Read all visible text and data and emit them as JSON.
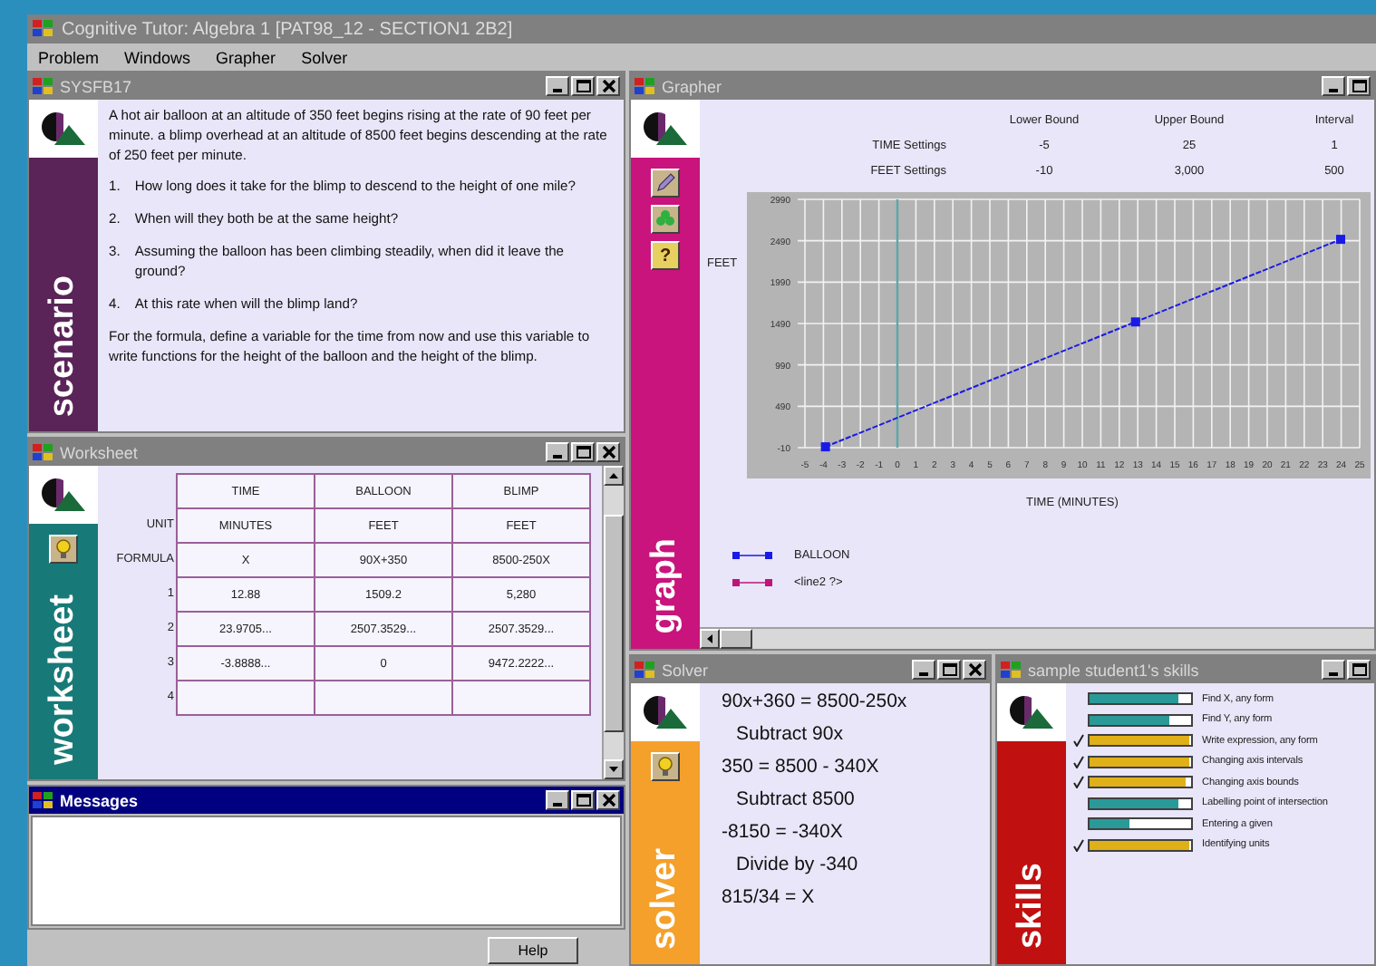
{
  "app": {
    "title": "Cognitive Tutor: Algebra 1  [PAT98_12 - SECTION1 2B2]"
  },
  "menu": [
    "Problem",
    "Windows",
    "Grapher",
    "Solver"
  ],
  "scenario": {
    "title": "SYSFB17",
    "active": false,
    "label": "scenario",
    "controls": [
      {
        "kind": "minimize"
      },
      {
        "kind": "maximize"
      },
      {
        "kind": "close"
      }
    ],
    "intro": "A hot air balloon at an altitude of 350 feet begins rising at the rate of 90 feet per minute. a blimp overhead at an altitude of 8500 feet begins descending at the rate of 250 feet per minute.",
    "questions": [
      {
        "number": "1.",
        "text": "How long does it take for the blimp to descend to the height of one mile?"
      },
      {
        "number": "2.",
        "text": "When will they both be at the same height?"
      },
      {
        "number": "3.",
        "text": "Assuming the balloon has been climbing steadily, when did it leave the ground?"
      },
      {
        "number": "4.",
        "text": "At this rate when will the blimp land?"
      }
    ],
    "closing": "For the formula, define a variable for the time from now and use this variable to write functions for the height of the balloon and the height of the blimp."
  },
  "worksheet": {
    "title": "Worksheet",
    "active": false,
    "label": "worksheet",
    "controls": [
      {
        "kind": "minimize"
      },
      {
        "kind": "maximize"
      },
      {
        "kind": "close"
      }
    ],
    "tools": [
      {
        "kind": "hint"
      }
    ],
    "columns": [
      "TIME",
      "BALLOON",
      "BLIMP"
    ],
    "rows": [
      {
        "label": "UNIT",
        "cells": [
          "MINUTES",
          "FEET",
          "FEET"
        ]
      },
      {
        "label": "FORMULA",
        "cells": [
          "X",
          "90X+350",
          "8500-250X"
        ]
      },
      {
        "label": "1",
        "cells": [
          "12.88",
          "1509.2",
          "5,280"
        ]
      },
      {
        "label": "2",
        "cells": [
          "23.9705...",
          "2507.3529...",
          "2507.3529..."
        ]
      },
      {
        "label": "3",
        "cells": [
          "-3.8888...",
          "0",
          "9472.2222..."
        ]
      },
      {
        "label": "4",
        "cells": [
          "",
          "",
          ""
        ]
      }
    ]
  },
  "messages": {
    "title": "Messages",
    "active": true,
    "controls": [
      {
        "kind": "minimize"
      },
      {
        "kind": "maximize"
      },
      {
        "kind": "close"
      }
    ]
  },
  "help_button": "Help",
  "grapher": {
    "title": "Grapher",
    "active": false,
    "label": "graph",
    "controls": [
      {
        "kind": "minimize"
      },
      {
        "kind": "maximize"
      }
    ],
    "tools": [
      {
        "kind": "pencil"
      },
      {
        "kind": "shapes"
      },
      {
        "kind": "help",
        "label": "?"
      }
    ],
    "settings": {
      "columns": [
        "Lower Bound",
        "Upper Bound",
        "Interval"
      ],
      "rows": [
        {
          "label": "TIME Settings",
          "values": [
            "-5",
            "25",
            "1"
          ]
        },
        {
          "label": "FEET Settings",
          "values": [
            "-10",
            "3,000",
            "500"
          ]
        }
      ]
    },
    "chart_data": {
      "type": "line",
      "grid": true,
      "xlabel": "TIME    (MINUTES)",
      "ylabel": "FEET",
      "x": [
        -3.89,
        12.88,
        23.97
      ],
      "series": [
        {
          "name": "BALLOON",
          "color": "#1a1ae6",
          "line_style": "dashed",
          "marker": "square",
          "values": [
            0,
            1509,
            2507
          ]
        },
        {
          "name": "<line2 ?>",
          "color": "#c0147a",
          "values": [
            null,
            null,
            null
          ]
        }
      ],
      "xlim": [
        -5,
        25
      ],
      "ylim": [
        -10,
        2990
      ],
      "xticks": [
        -5,
        -4,
        -3,
        -2,
        -1,
        0,
        1,
        2,
        3,
        4,
        5,
        6,
        7,
        8,
        9,
        10,
        11,
        12,
        13,
        14,
        15,
        16,
        17,
        18,
        19,
        20,
        21,
        22,
        23,
        24,
        25
      ],
      "yticks": [
        -10,
        490,
        990,
        1490,
        1990,
        2490,
        2990
      ],
      "ref_lines": [
        {
          "axis": "x",
          "value": 0
        }
      ]
    }
  },
  "solver": {
    "title": "Solver",
    "active": false,
    "label": "solver",
    "controls": [
      {
        "kind": "minimize"
      },
      {
        "kind": "maximize"
      },
      {
        "kind": "close"
      }
    ],
    "tools": [
      {
        "kind": "hint"
      }
    ],
    "lines": [
      {
        "kind": "equation",
        "text": "90x+360 = 8500-250x"
      },
      {
        "kind": "step",
        "text": "Subtract 90x"
      },
      {
        "kind": "equation",
        "text": "350 = 8500 - 340X"
      },
      {
        "kind": "step",
        "text": "Subtract 8500"
      },
      {
        "kind": "equation",
        "text": "-8150 = -340X"
      },
      {
        "kind": "step",
        "text": "Divide by -340"
      },
      {
        "kind": "equation",
        "text": "815/34 = X"
      }
    ]
  },
  "skills": {
    "title": "sample student1's skills",
    "active": false,
    "label": "skills",
    "controls": [
      {
        "kind": "minimize"
      },
      {
        "kind": "maximize"
      }
    ],
    "items": [
      {
        "name": "Find X, any form",
        "level": 0.88,
        "checked": false
      },
      {
        "name": "Find Y, any form",
        "level": 0.78,
        "checked": false
      },
      {
        "name": "Write expression, any form",
        "level": 0.98,
        "checked": true
      },
      {
        "name": "Changing axis intervals",
        "level": 0.98,
        "checked": true
      },
      {
        "name": "Changing axis bounds",
        "level": 0.95,
        "checked": true
      },
      {
        "name": "Labelling point of intersection",
        "level": 0.88,
        "checked": false
      },
      {
        "name": "Entering a given",
        "level": 0.4,
        "checked": false
      },
      {
        "name": "Identifying units",
        "level": 0.98,
        "checked": true
      }
    ]
  }
}
